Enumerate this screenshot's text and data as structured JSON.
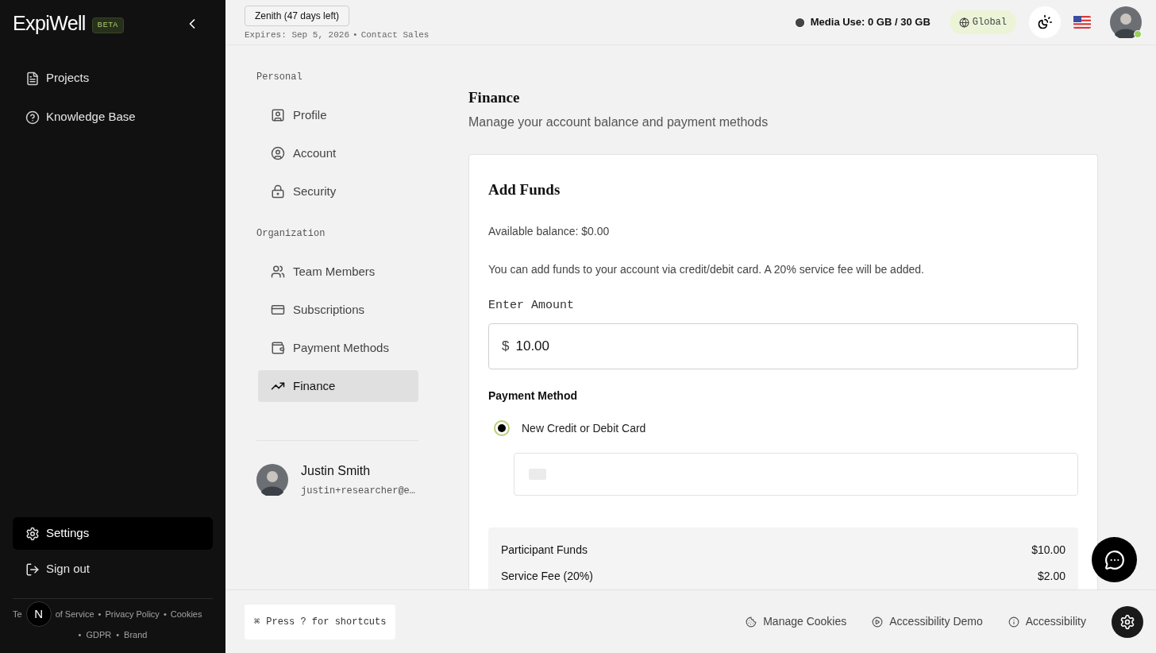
{
  "sidebar": {
    "logo": "ExpiWell",
    "badge": "BETA",
    "items": [
      {
        "label": "Projects",
        "selected": false
      },
      {
        "label": "Knowledge Base",
        "selected": false
      }
    ],
    "bottom_items": [
      {
        "label": "Settings",
        "selected": true
      },
      {
        "label": "Sign out",
        "selected": false
      }
    ],
    "footer_links": [
      {
        "label": "Te"
      },
      {
        "label": "of Service"
      },
      {
        "label": "Privacy Policy"
      },
      {
        "label": "Cookies"
      },
      {
        "label": "GDPR"
      },
      {
        "label": "Brand"
      }
    ],
    "footer_separator": "•",
    "dev_badge": "N"
  },
  "header": {
    "plan": "Zenith (47 days left)",
    "expires": "Expires: Sep 5, 2026",
    "separator": "•",
    "contact": "Contact Sales",
    "media_use": "Media Use: 0 GB / 30 GB",
    "region": "Global"
  },
  "settings_nav": {
    "sections": [
      {
        "title": "Personal",
        "items": [
          {
            "label": "Profile",
            "selected": false
          },
          {
            "label": "Account",
            "selected": false
          },
          {
            "label": "Security",
            "selected": false
          }
        ]
      },
      {
        "title": "Organization",
        "items": [
          {
            "label": "Team Members",
            "selected": false
          },
          {
            "label": "Subscriptions",
            "selected": false
          },
          {
            "label": "Payment Methods",
            "selected": false
          },
          {
            "label": "Finance",
            "selected": true
          }
        ]
      }
    ],
    "user": {
      "name": "Justin Smith",
      "email": "justin+researcher@e…"
    }
  },
  "page": {
    "title": "Finance",
    "subtitle": "Manage your account balance and payment methods",
    "card": {
      "title": "Add Funds",
      "balance": "Available balance: $0.00",
      "note": "You can add funds to your account via credit/debit card. A 20% service fee will be added.",
      "amount_label": "Enter Amount",
      "currency": "$",
      "amount": "10.00",
      "method_label": "Payment Method",
      "methods": [
        {
          "label": "New Credit or Debit Card",
          "selected": true
        }
      ],
      "summary": [
        {
          "label": "Participant Funds",
          "value": "$10.00"
        },
        {
          "label": "Service Fee (20%)",
          "value": "$2.00"
        }
      ]
    }
  },
  "footer": {
    "shortcut_key": "⌘",
    "shortcut": "Press ? for shortcuts",
    "links": [
      {
        "label": "Manage Cookies"
      },
      {
        "label": "Accessibility Demo"
      },
      {
        "label": "Accessibility"
      }
    ]
  }
}
